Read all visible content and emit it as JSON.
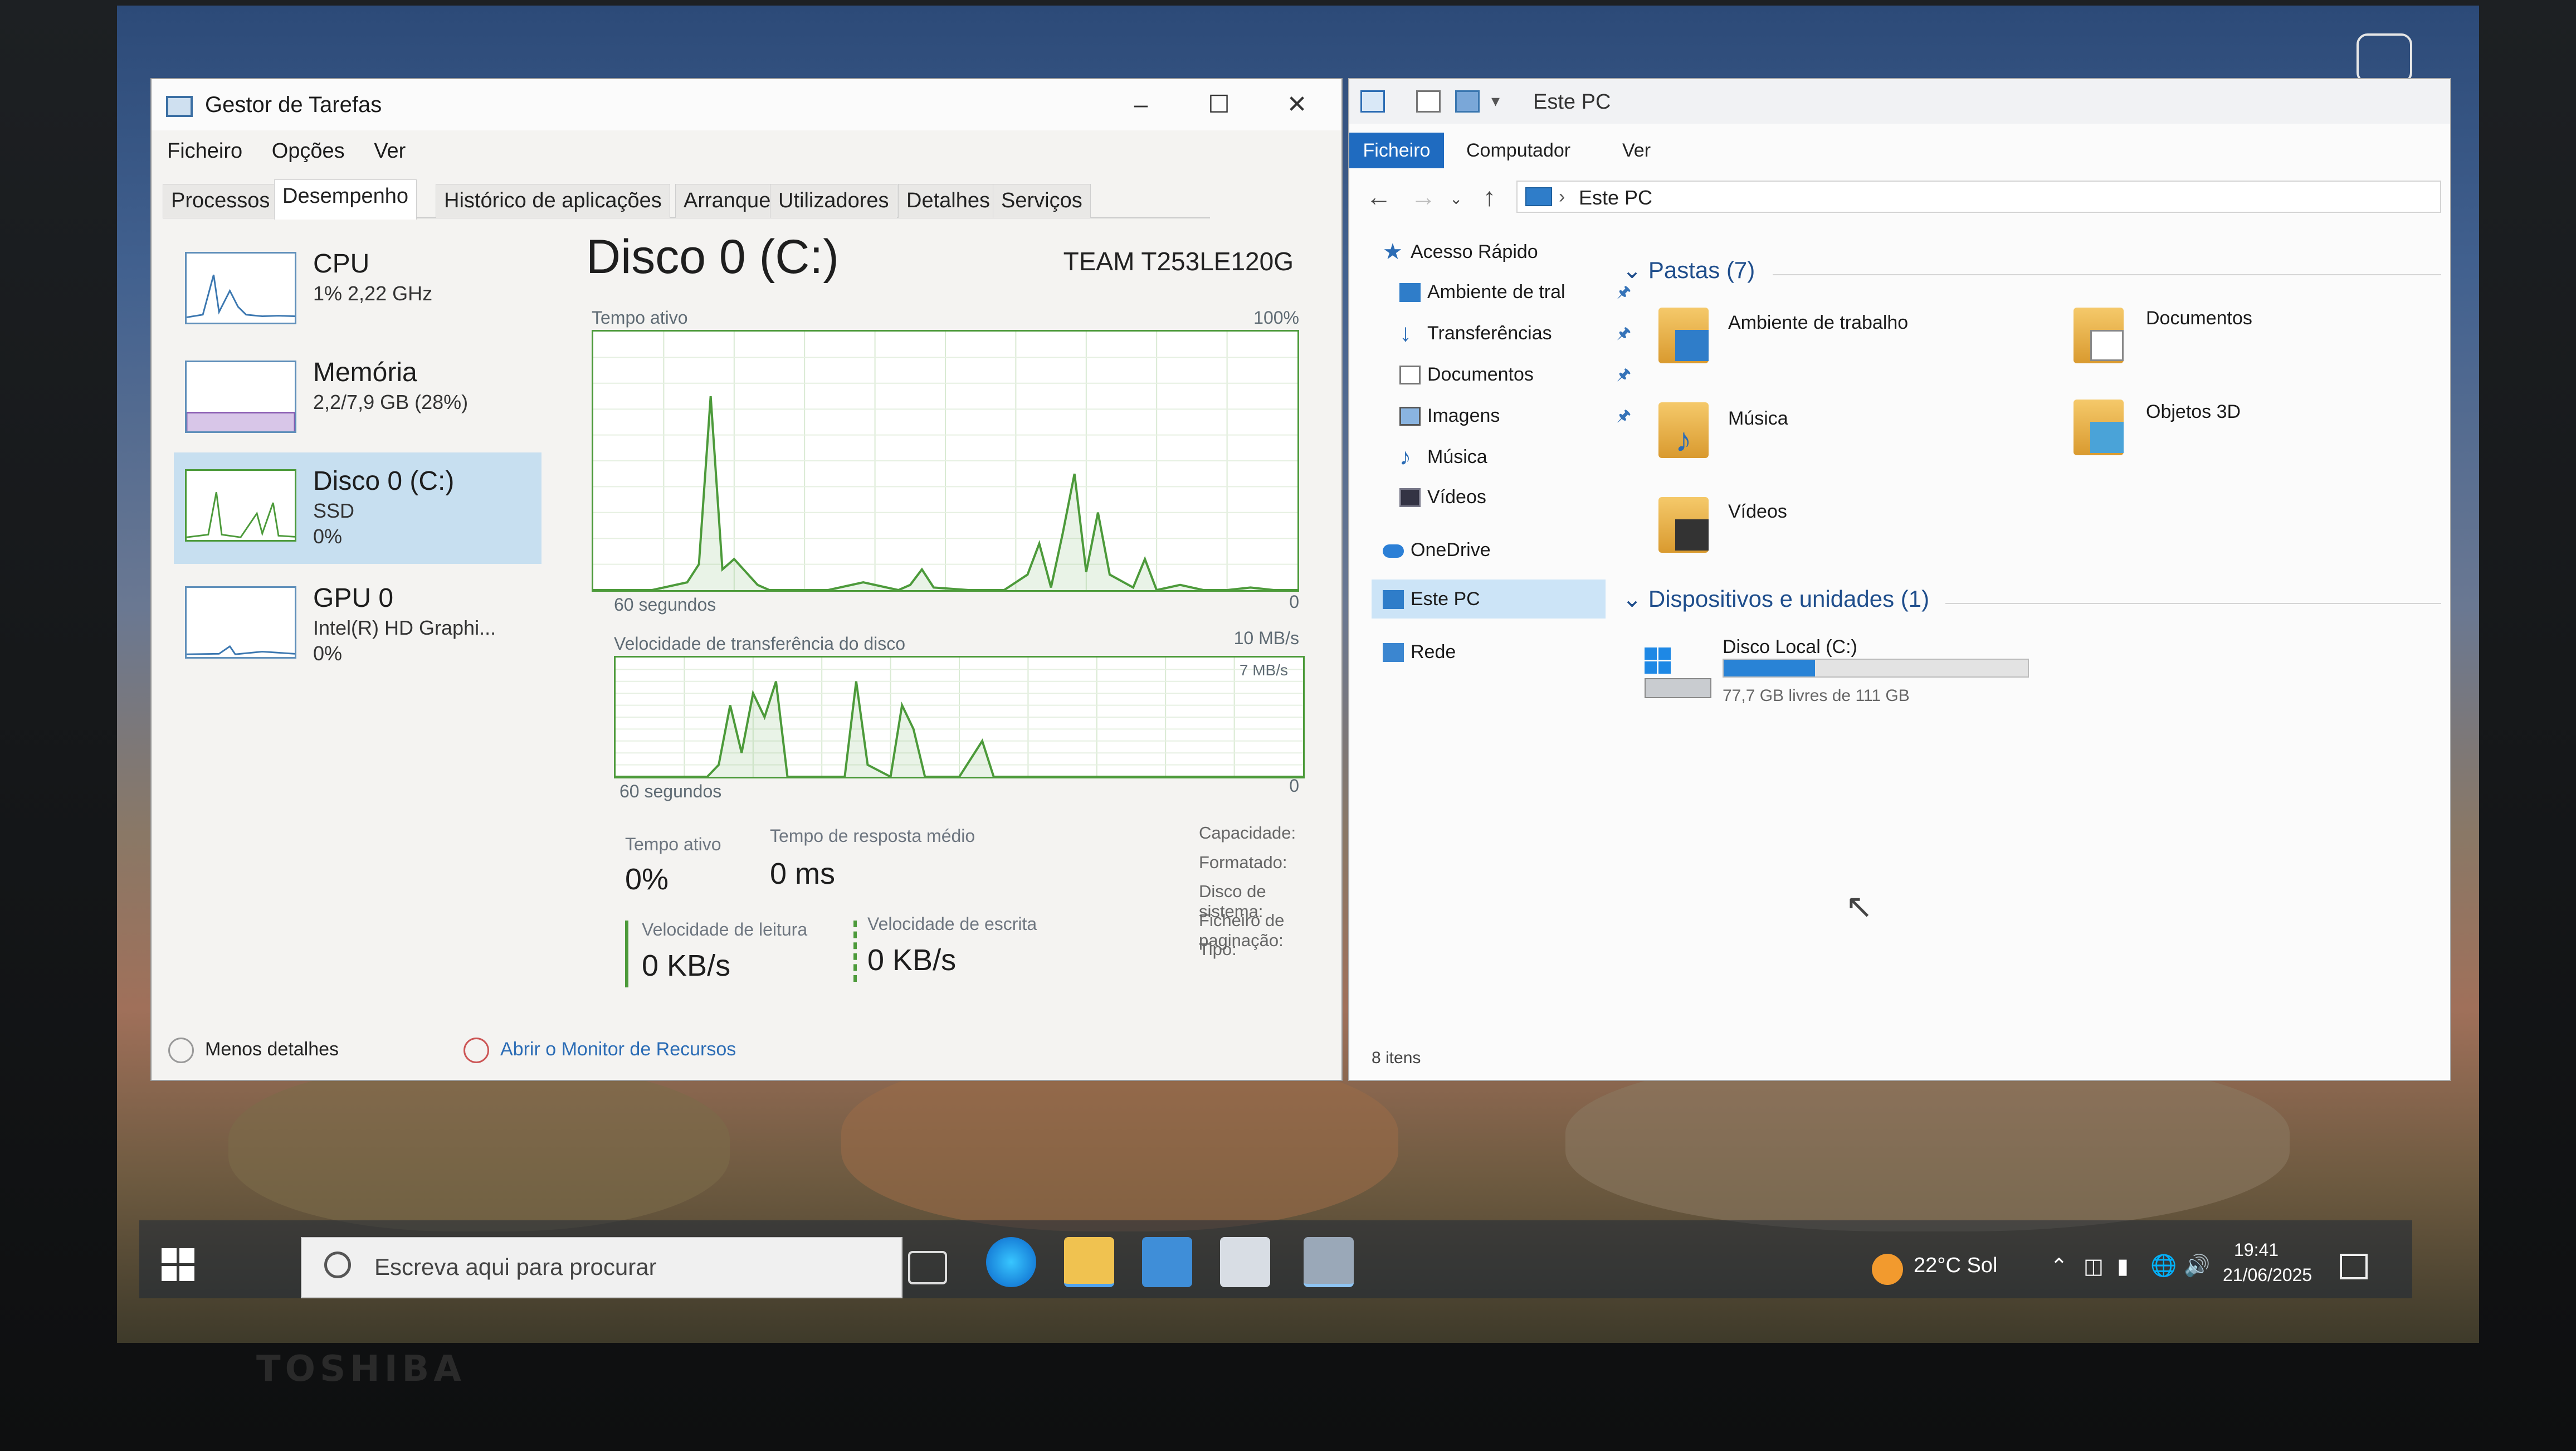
{
  "task_manager": {
    "title": "Gestor de Tarefas",
    "menu": [
      "Ficheiro",
      "Opções",
      "Ver"
    ],
    "tabs": [
      "Processos",
      "Desempenho",
      "Histórico de aplicações",
      "Arranque",
      "Utilizadores",
      "Detalhes",
      "Serviços"
    ],
    "active_tab": "Desempenho",
    "sidebar": [
      {
        "name": "CPU",
        "sub1": "1% 2,22 GHz",
        "sub2": ""
      },
      {
        "name": "Memória",
        "sub1": "2,2/7,9 GB (28%)",
        "sub2": ""
      },
      {
        "name": "Disco 0 (C:)",
        "sub1": "SSD",
        "sub2": "0%"
      },
      {
        "name": "GPU 0",
        "sub1": "Intel(R) HD Graphi...",
        "sub2": "0%"
      }
    ],
    "main": {
      "title": "Disco 0 (C:)",
      "model": "TEAM T253LE120G",
      "graph1_label": "Tempo ativo",
      "graph1_max": "100%",
      "graph1_time": "60 segundos",
      "graph1_min": "0",
      "graph2_label": "Velocidade de transferência do disco",
      "graph2_max": "10 MB/s",
      "graph2_mark": "7 MB/s",
      "graph2_time": "60 segundos",
      "graph2_min": "0",
      "stat_active_label": "Tempo ativo",
      "stat_active_value": "0%",
      "stat_resp_label": "Tempo de resposta médio",
      "stat_resp_value": "0 ms",
      "stat_read_label": "Velocidade de leitura",
      "stat_read_value": "0 KB/s",
      "stat_write_label": "Velocidade de escrita",
      "stat_write_value": "0 KB/s",
      "info": [
        "Capacidade:",
        "Formatado:",
        "Disco de sistema:",
        "Ficheiro de paginação:",
        "Tipo:"
      ]
    },
    "footer": {
      "less": "Menos detalhes",
      "monitor": "Abrir o Monitor de Recursos"
    }
  },
  "explorer": {
    "title": "Este PC",
    "ribbon": [
      "Ficheiro",
      "Computador",
      "Ver"
    ],
    "address": "Este PC",
    "nav": {
      "quick": "Acesso Rápido",
      "items": [
        "Ambiente de tral",
        "Transferências",
        "Documentos",
        "Imagens",
        "Música",
        "Vídeos"
      ],
      "onedrive": "OneDrive",
      "pc": "Este PC",
      "network": "Rede"
    },
    "folders_header": "Pastas (7)",
    "folders": [
      "Ambiente de trabalho",
      "Documentos",
      "Música",
      "Objetos 3D",
      "Vídeos"
    ],
    "devices_header": "Dispositivos e unidades (1)",
    "drive": {
      "name": "Disco Local (C:)",
      "free": "77,7 GB livres de 111 GB",
      "used_fraction": 0.3
    },
    "status": "8 itens"
  },
  "taskbar": {
    "search_placeholder": "Escreva aqui para procurar",
    "weather": "22°C  Sol",
    "time": "19:41",
    "date": "21/06/2025"
  },
  "bezel_brand": "TOSHIBA",
  "colors": {
    "accent": "#1f6bc0",
    "graph_green": "#4c9a3a",
    "selection": "#c7dff0"
  },
  "chart_data": [
    {
      "type": "area",
      "title": "Tempo ativo",
      "ylim": [
        0,
        100
      ],
      "x": [
        0,
        5,
        8,
        9,
        10,
        11,
        12,
        14,
        15,
        20,
        23,
        26,
        27,
        28,
        29,
        32,
        35,
        37,
        38,
        39,
        40,
        41,
        42,
        43,
        44,
        46,
        47,
        48,
        50,
        52,
        54,
        56,
        58,
        60
      ],
      "values": [
        0,
        0,
        3,
        10,
        75,
        8,
        12,
        2,
        0,
        0,
        3,
        0,
        2,
        8,
        1,
        0,
        0,
        6,
        18,
        1,
        22,
        45,
        7,
        30,
        6,
        1,
        12,
        0,
        2,
        0,
        0,
        1,
        0,
        0
      ]
    },
    {
      "type": "area",
      "title": "Velocidade de transferência do disco",
      "ylim": [
        0,
        10
      ],
      "x": [
        0,
        8,
        9,
        10,
        11,
        12,
        13,
        14,
        15,
        20,
        21,
        22,
        24,
        25,
        26,
        27,
        30,
        32,
        33,
        34,
        36,
        40,
        58,
        60
      ],
      "values": [
        0,
        0,
        1,
        6,
        2,
        7,
        5,
        8,
        0,
        0,
        8,
        1,
        0,
        6,
        4,
        0,
        0,
        3,
        0,
        0,
        0,
        0,
        0,
        0
      ]
    }
  ]
}
